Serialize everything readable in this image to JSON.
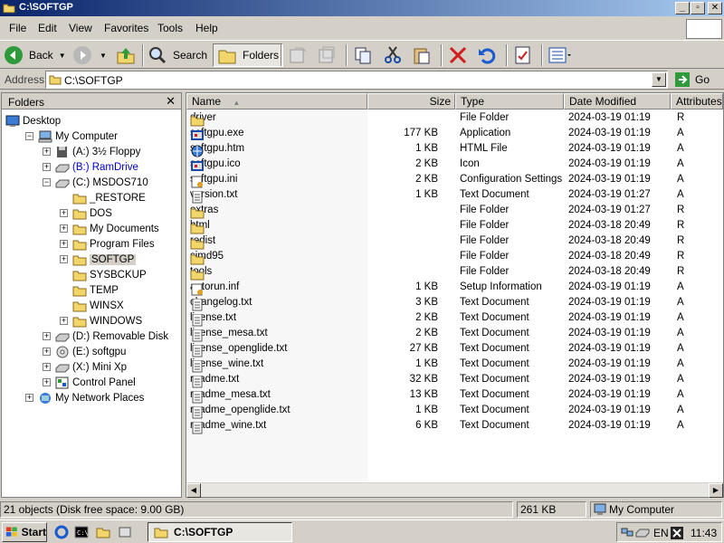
{
  "window": {
    "title": "C:\\SOFTGP"
  },
  "menu": [
    "File",
    "Edit",
    "View",
    "Favorites",
    "Tools",
    "Help"
  ],
  "toolbar": {
    "back": "Back",
    "search": "Search",
    "folders": "Folders"
  },
  "address": {
    "label": "Address",
    "value": "C:\\SOFTGP",
    "go": "Go"
  },
  "folders_pane": {
    "title": "Folders",
    "nodes": [
      {
        "label": "Desktop"
      },
      {
        "label": "My Computer"
      },
      {
        "label": "(A:) 3½ Floppy"
      },
      {
        "label": "(B:) RamDrive"
      },
      {
        "label": "(C:) MSDOS710"
      },
      {
        "label": "_RESTORE"
      },
      {
        "label": "DOS"
      },
      {
        "label": "My Documents"
      },
      {
        "label": "Program Files"
      },
      {
        "label": "SOFTGP"
      },
      {
        "label": "SYSBCKUP"
      },
      {
        "label": "TEMP"
      },
      {
        "label": "WINSX"
      },
      {
        "label": "WINDOWS"
      },
      {
        "label": "(D:) Removable Disk"
      },
      {
        "label": "(E:) softgpu"
      },
      {
        "label": "(X:) Mini Xp"
      },
      {
        "label": "Control Panel"
      },
      {
        "label": "My Network Places"
      }
    ]
  },
  "columns": {
    "name": "Name",
    "size": "Size",
    "type": "Type",
    "modified": "Date Modified",
    "attributes": "Attributes"
  },
  "files": [
    {
      "name": "driver",
      "size": "",
      "type": "File Folder",
      "modified": "2024-03-19 01:19",
      "attr": "R",
      "icon": "folder"
    },
    {
      "name": "softgpu.exe",
      "size": "177 KB",
      "type": "Application",
      "modified": "2024-03-19 01:19",
      "attr": "A",
      "icon": "app"
    },
    {
      "name": "softgpu.htm",
      "size": "1 KB",
      "type": "HTML File",
      "modified": "2024-03-19 01:19",
      "attr": "A",
      "icon": "html"
    },
    {
      "name": "softgpu.ico",
      "size": "2 KB",
      "type": "Icon",
      "modified": "2024-03-19 01:19",
      "attr": "A",
      "icon": "app"
    },
    {
      "name": "softgpu.ini",
      "size": "2 KB",
      "type": "Configuration Settings",
      "modified": "2024-03-19 01:19",
      "attr": "A",
      "icon": "ini"
    },
    {
      "name": "version.txt",
      "size": "1 KB",
      "type": "Text Document",
      "modified": "2024-03-19 01:27",
      "attr": "A",
      "icon": "txt"
    },
    {
      "name": "extras",
      "size": "",
      "type": "File Folder",
      "modified": "2024-03-19 01:27",
      "attr": "R",
      "icon": "folder"
    },
    {
      "name": "html",
      "size": "",
      "type": "File Folder",
      "modified": "2024-03-18 20:49",
      "attr": "R",
      "icon": "folder"
    },
    {
      "name": "redist",
      "size": "",
      "type": "File Folder",
      "modified": "2024-03-18 20:49",
      "attr": "R",
      "icon": "folder"
    },
    {
      "name": "simd95",
      "size": "",
      "type": "File Folder",
      "modified": "2024-03-18 20:49",
      "attr": "R",
      "icon": "folder"
    },
    {
      "name": "tools",
      "size": "",
      "type": "File Folder",
      "modified": "2024-03-18 20:49",
      "attr": "R",
      "icon": "folder"
    },
    {
      "name": "autorun.inf",
      "size": "1 KB",
      "type": "Setup Information",
      "modified": "2024-03-19 01:19",
      "attr": "A",
      "icon": "ini"
    },
    {
      "name": "changelog.txt",
      "size": "3 KB",
      "type": "Text Document",
      "modified": "2024-03-19 01:19",
      "attr": "A",
      "icon": "txt"
    },
    {
      "name": "license.txt",
      "size": "2 KB",
      "type": "Text Document",
      "modified": "2024-03-19 01:19",
      "attr": "A",
      "icon": "txt"
    },
    {
      "name": "license_mesa.txt",
      "size": "2 KB",
      "type": "Text Document",
      "modified": "2024-03-19 01:19",
      "attr": "A",
      "icon": "txt"
    },
    {
      "name": "license_openglide.txt",
      "size": "27 KB",
      "type": "Text Document",
      "modified": "2024-03-19 01:19",
      "attr": "A",
      "icon": "txt"
    },
    {
      "name": "license_wine.txt",
      "size": "1 KB",
      "type": "Text Document",
      "modified": "2024-03-19 01:19",
      "attr": "A",
      "icon": "txt"
    },
    {
      "name": "readme.txt",
      "size": "32 KB",
      "type": "Text Document",
      "modified": "2024-03-19 01:19",
      "attr": "A",
      "icon": "txt"
    },
    {
      "name": "readme_mesa.txt",
      "size": "13 KB",
      "type": "Text Document",
      "modified": "2024-03-19 01:19",
      "attr": "A",
      "icon": "txt"
    },
    {
      "name": "readme_openglide.txt",
      "size": "1 KB",
      "type": "Text Document",
      "modified": "2024-03-19 01:19",
      "attr": "A",
      "icon": "txt"
    },
    {
      "name": "readme_wine.txt",
      "size": "6 KB",
      "type": "Text Document",
      "modified": "2024-03-19 01:19",
      "attr": "A",
      "icon": "txt"
    }
  ],
  "status": {
    "objects": "21 objects (Disk free space: 9.00 GB)",
    "size": "261 KB",
    "location": "My Computer"
  },
  "taskbar": {
    "start": "Start",
    "task": "C:\\SOFTGP",
    "lang": "EN",
    "time": "11:43"
  }
}
